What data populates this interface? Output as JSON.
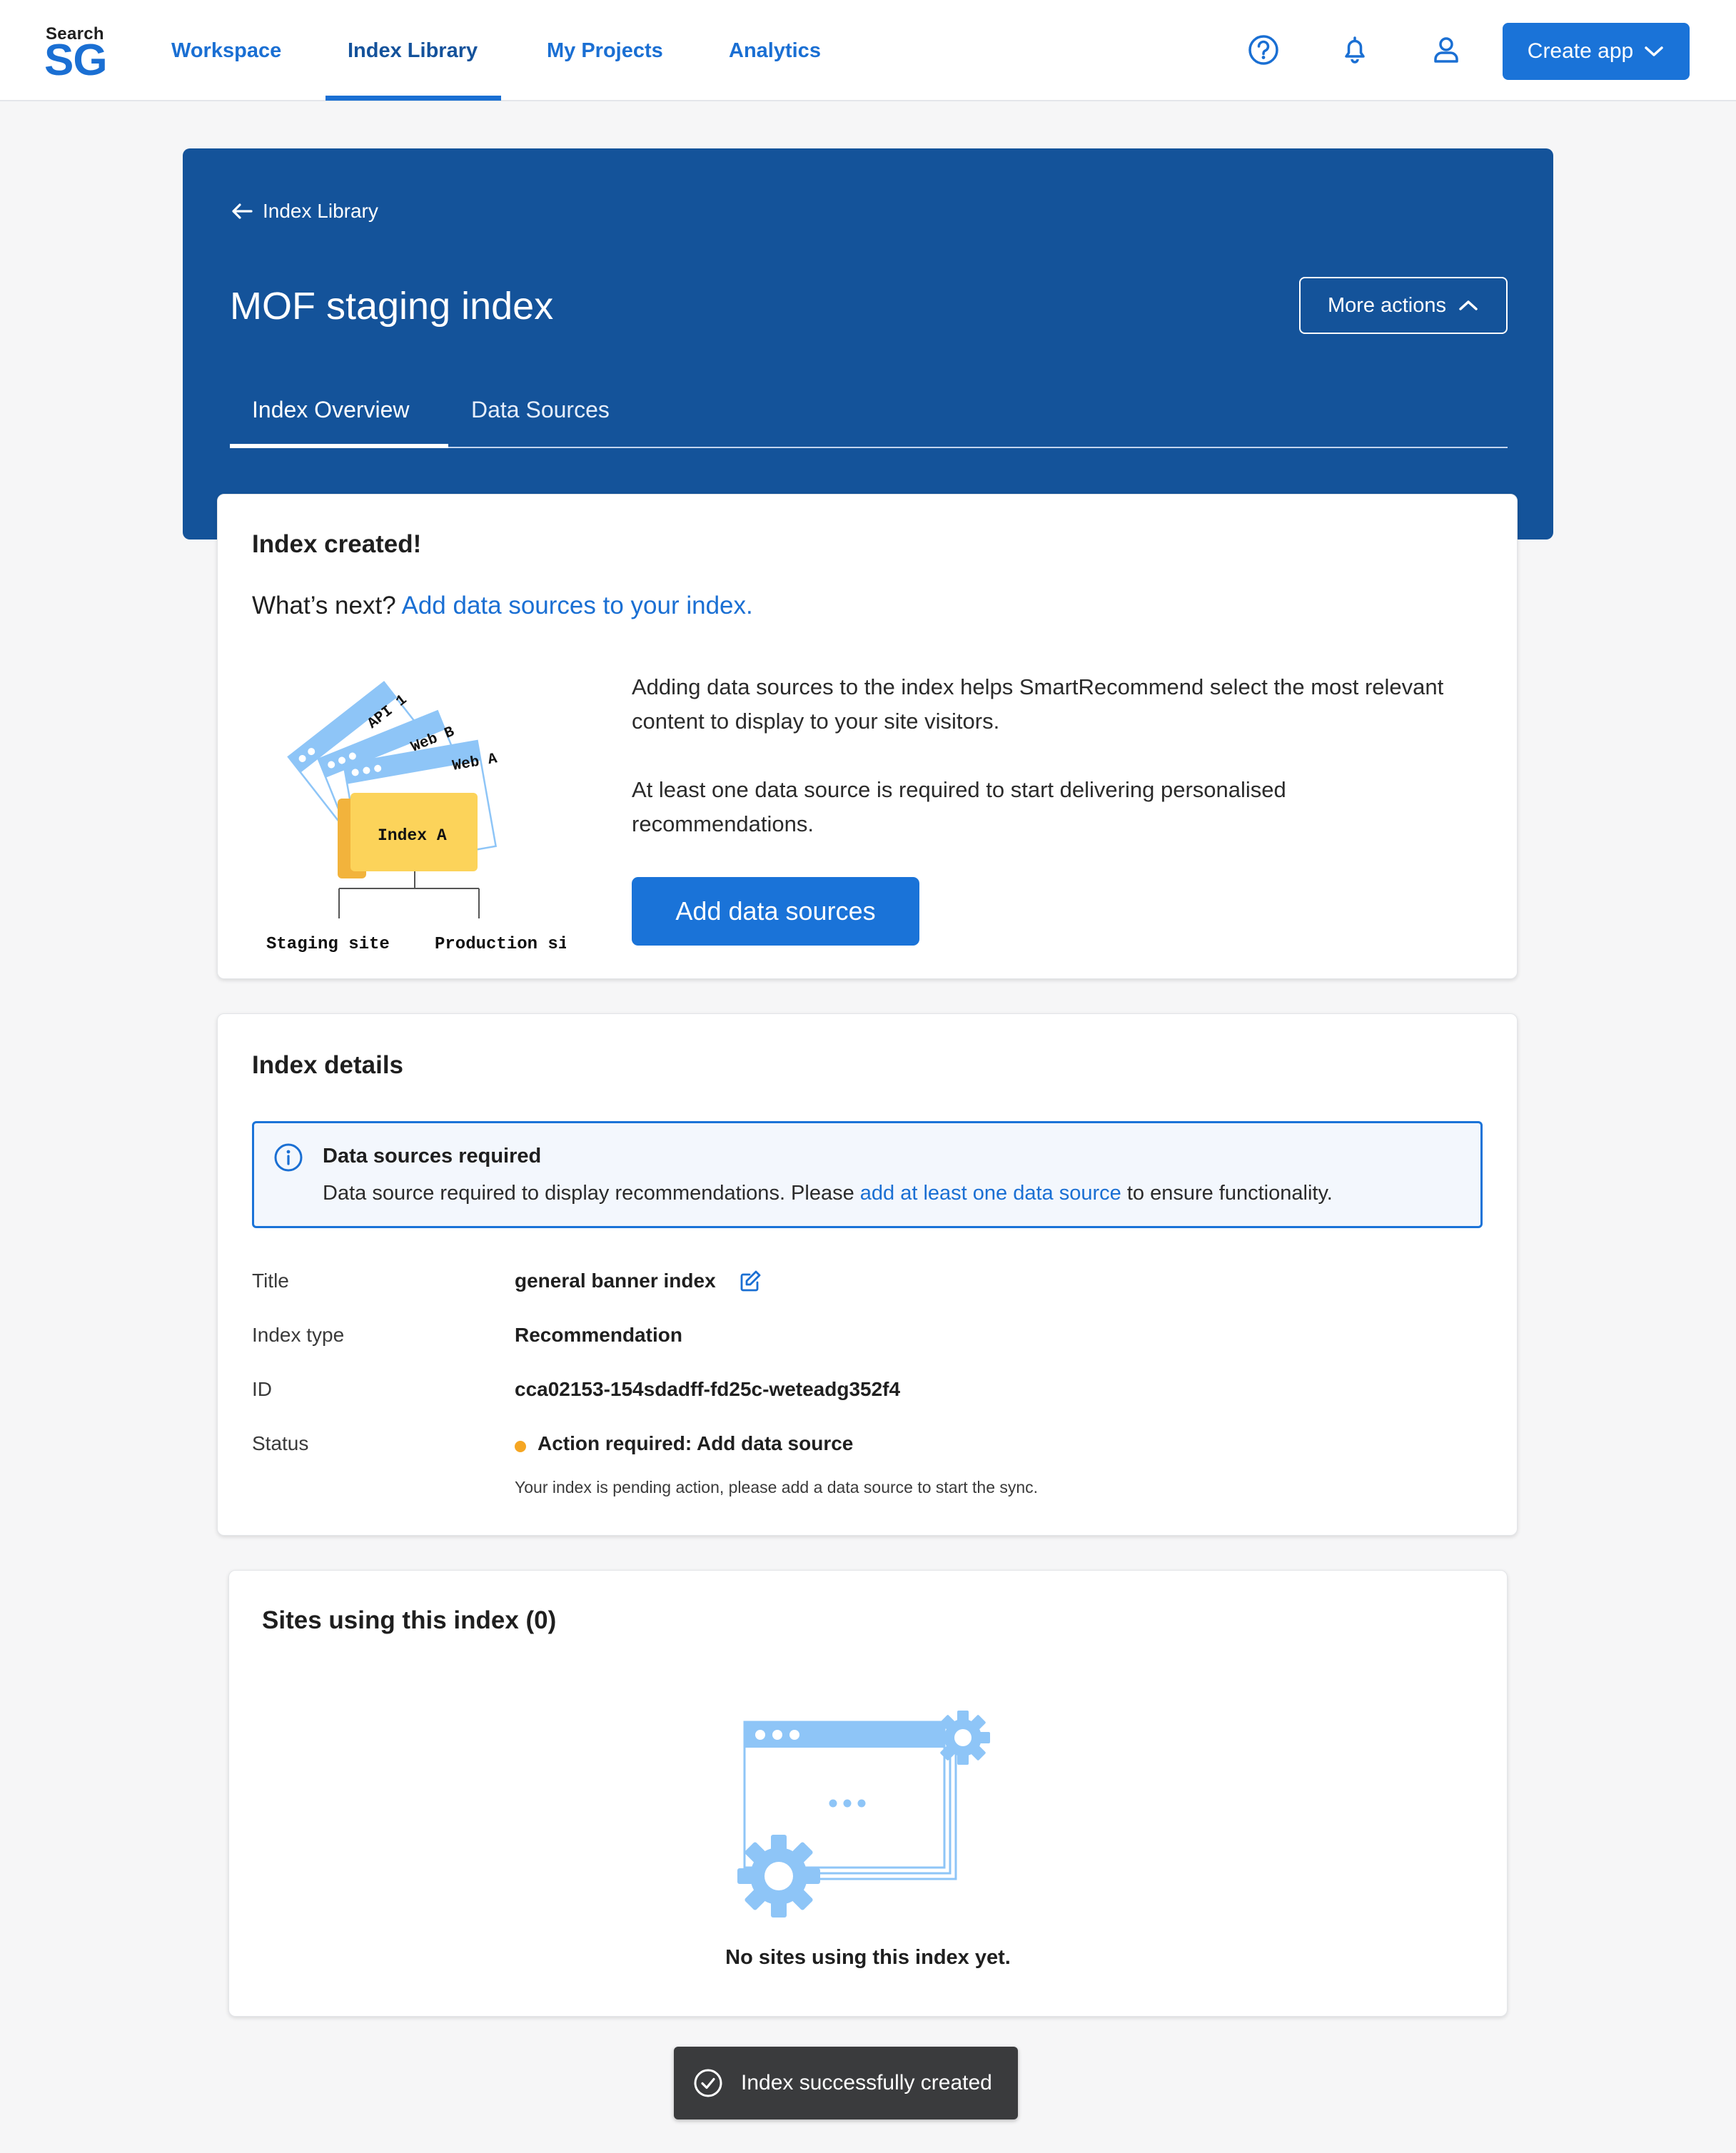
{
  "brand": {
    "small": "Search",
    "big": "SG"
  },
  "nav": {
    "links": [
      "Workspace",
      "Index Library",
      "My Projects",
      "Analytics"
    ],
    "create_label": "Create app",
    "icons": [
      "help-icon",
      "bell-icon",
      "user-icon"
    ]
  },
  "header": {
    "back_label": "Index Library",
    "title": "MOF staging index",
    "more_actions_label": "More actions",
    "tabs": [
      "Index Overview",
      "Data Sources"
    ]
  },
  "created_card": {
    "title": "Index created!",
    "next_prefix": "What’s next? ",
    "next_link": "Add data sources to your index.",
    "para1": "Adding data sources to the index helps SmartRecommend select the most relevant content to display to your site visitors.",
    "para2": "At least one data source is required to start delivering personalised recommendations.",
    "button_label": "Add data sources",
    "illustration": {
      "cards": [
        "API 1",
        "Web B",
        "Web A"
      ],
      "index_label": "Index A",
      "sites": [
        "Staging site",
        "Production site"
      ]
    }
  },
  "details_card": {
    "title": "Index details",
    "alert": {
      "title": "Data sources required",
      "text_prefix": "Data source required to display recommendations. Please ",
      "text_link": "add at least one data source",
      "text_suffix": " to ensure functionality."
    },
    "rows": [
      {
        "label": "Title",
        "value": "general banner index"
      },
      {
        "label": "Index type",
        "value": "Recommendation"
      },
      {
        "label": "ID",
        "value": "cca02153-154sdadff-fd25c-weteadg352f4"
      },
      {
        "label": "Status",
        "value": "Action required: Add data source"
      }
    ],
    "status_note": "Your index is pending action, please add a data source to start the sync.",
    "status_color": "#f5a623"
  },
  "sites_card": {
    "title": "Sites using this index (0)",
    "empty_text": "No sites using this index yet."
  },
  "toast": {
    "text": "Index successfully created"
  },
  "colors": {
    "primary": "#1a73d8",
    "header": "#14539a",
    "illustration_blue": "#8ec5f7",
    "folder": "#fcd35a"
  }
}
